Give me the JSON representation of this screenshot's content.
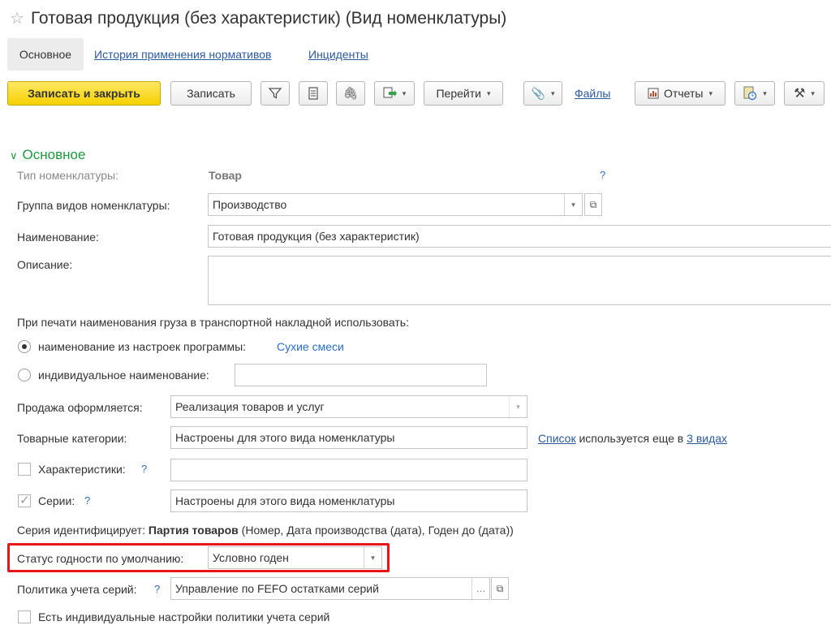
{
  "window": {
    "title": "Готовая продукция (без характеристик) (Вид номенклатуры)",
    "favorite_icon": "star-icon"
  },
  "tabs": [
    {
      "label": "Основное",
      "active": true
    },
    {
      "label": "История применения нормативов",
      "active": false
    },
    {
      "label": "Инциденты",
      "active": false
    }
  ],
  "toolbar": {
    "save_close": "Записать и закрыть",
    "save": "Записать",
    "goto": "Перейти",
    "files": "Файлы",
    "reports": "Отчеты",
    "icons": [
      "filter-icon",
      "list-icon",
      "paperclip-icon",
      "create-based-on-icon",
      "attach-icon",
      "reports-icon",
      "print-settings-icon",
      "tools-icon"
    ]
  },
  "section": {
    "title": "Основное"
  },
  "form": {
    "type_label": "Тип номенклатуры:",
    "type_value": "Товар",
    "help": "?",
    "group_label": "Группа видов номенклатуры:",
    "group_value": "Производство",
    "name_label": "Наименование:",
    "name_value": "Готовая продукция (без характеристик)",
    "desc_label": "Описание:",
    "desc_value": "",
    "print_caption": "При печати наименования груза в транспортной накладной использовать:",
    "radio1_label": "наименование из настроек программы:",
    "radio1_value": "Сухие смеси",
    "radio2_label": "индивидуальное наименование:",
    "radio2_value": "",
    "sale_label": "Продажа оформляется:",
    "sale_value": "Реализация товаров и услуг",
    "categories_label": "Товарные категории:",
    "categories_value": "Настроены для этого вида номенклатуры",
    "categories_link": "Список",
    "categories_text": "используется еще в",
    "categories_link2": "3 видах",
    "characteristics_label": "Характеристики:",
    "characteristics_checked": false,
    "characteristics_value": "",
    "series_label": "Серии:",
    "series_checked": true,
    "series_value": "Настроены для этого вида номенклатуры",
    "series_ident_prefix": "Серия идентифицирует:",
    "series_ident_bold": "Партия товаров",
    "series_ident_rest": "(Номер, Дата производства (дата), Годен до (дата))",
    "status_label": "Статус годности по умолчанию:",
    "status_value": "Условно годен",
    "policy_label": "Политика учета серий:",
    "policy_value": "Управление по FEFO остатками серий",
    "individual_label": "Есть индивидуальные настройки политики учета серий",
    "individual_checked": false
  },
  "colors": {
    "primary_button": "#f4d000",
    "section_title": "#1e9b3c",
    "link": "#2a5aa0",
    "highlight": "#e8151b"
  }
}
